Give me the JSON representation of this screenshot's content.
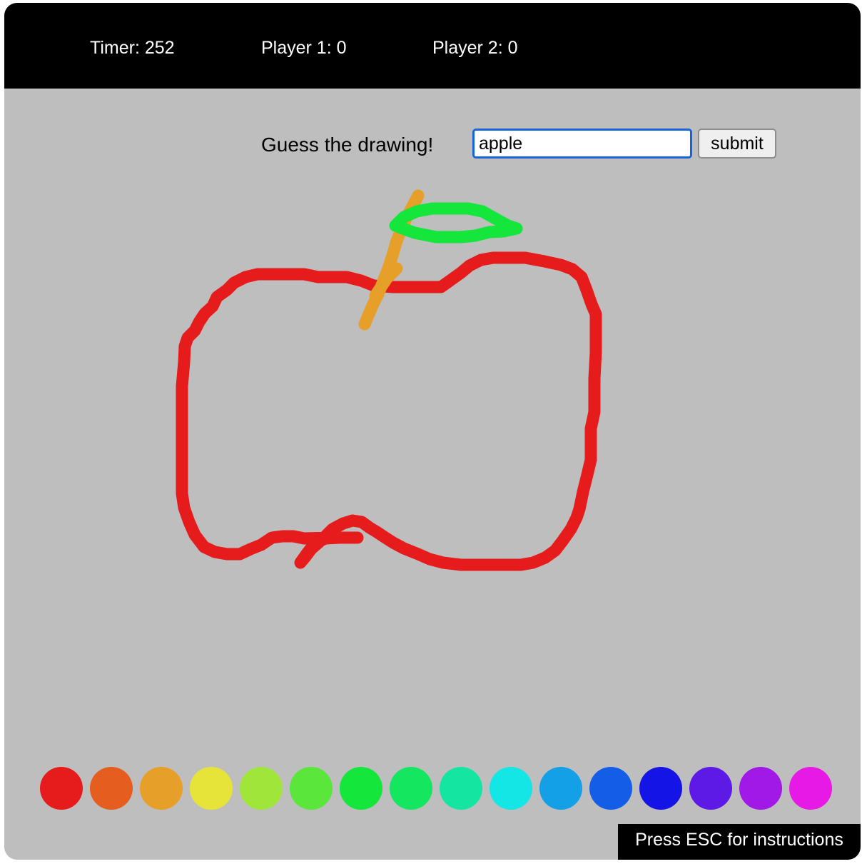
{
  "header": {
    "timer": "Timer: 252",
    "player1": "Player 1: 0",
    "player2": "Player 2: 0"
  },
  "guess": {
    "prompt": "Guess the drawing!",
    "input_value": "apple",
    "submit_label": "submit"
  },
  "palette": {
    "colors": [
      "#e61c1c",
      "#e55d1f",
      "#e6a02a",
      "#e6e438",
      "#a0e63a",
      "#5be63b",
      "#14e63b",
      "#14e660",
      "#14e6a2",
      "#14e6e6",
      "#14a0e6",
      "#145de6",
      "#1414e6",
      "#5d19e6",
      "#a019e6",
      "#e619e6"
    ]
  },
  "canvas": {
    "stroke_colors": {
      "apple_body": "#e61c1c",
      "stem": "#e6a02a",
      "leaf": "#14e63b"
    }
  },
  "footer": {
    "hint": "Press ESC for instructions"
  }
}
